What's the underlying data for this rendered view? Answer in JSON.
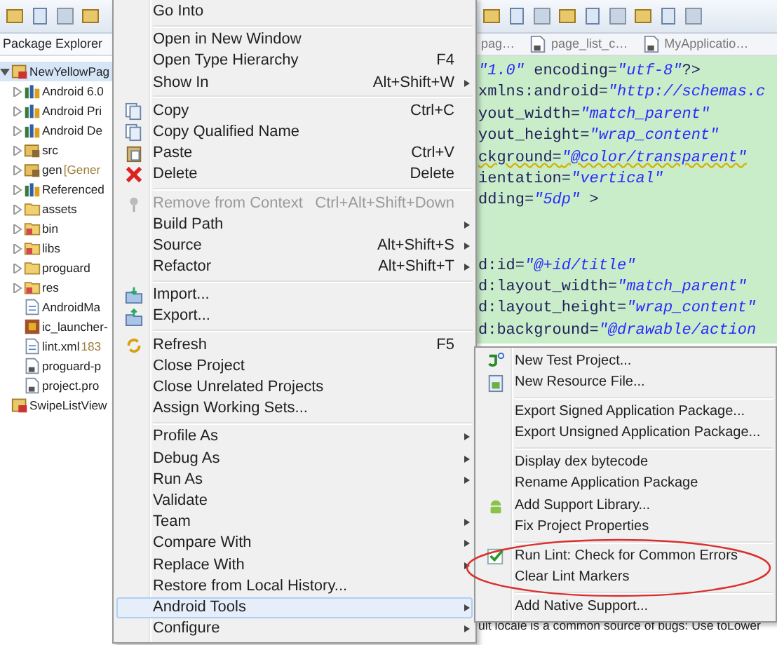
{
  "package_explorer": {
    "title": "Package Explorer",
    "tree": [
      {
        "label": "NewYellowPag",
        "kind": "project",
        "selected": true,
        "expanded": true,
        "children": [
          {
            "label": "Android 6.0",
            "kind": "library",
            "selected": false,
            "expanded": false
          },
          {
            "label": "Android Pri",
            "kind": "library",
            "selected": false,
            "expanded": false
          },
          {
            "label": "Android De",
            "kind": "library",
            "selected": false,
            "expanded": false
          },
          {
            "label": "src",
            "kind": "package",
            "selected": false,
            "expanded": false
          },
          {
            "label": "gen",
            "decoration": "[Gener",
            "kind": "package",
            "selected": false,
            "expanded": false
          },
          {
            "label": "Referenced",
            "kind": "library",
            "selected": false,
            "expanded": false
          },
          {
            "label": "assets",
            "kind": "folder",
            "selected": false,
            "expanded": false
          },
          {
            "label": "bin",
            "kind": "resfolder",
            "selected": false,
            "expanded": false
          },
          {
            "label": "libs",
            "kind": "resfolder",
            "selected": false,
            "expanded": false
          },
          {
            "label": "proguard",
            "kind": "folder",
            "selected": false,
            "expanded": false
          },
          {
            "label": "res",
            "kind": "resfolder",
            "selected": false,
            "expanded": false
          },
          {
            "label": "AndroidMa",
            "kind": "xml",
            "selected": false
          },
          {
            "label": "ic_launcher-",
            "kind": "image",
            "selected": false
          },
          {
            "label": "lint.xml",
            "decoration": "183",
            "kind": "xml",
            "selected": false
          },
          {
            "label": "proguard-p",
            "kind": "file",
            "selected": false
          },
          {
            "label": "project.pro",
            "kind": "file",
            "selected": false
          }
        ]
      },
      {
        "label": "SwipeListView",
        "kind": "project",
        "selected": false
      }
    ]
  },
  "context_menu": {
    "items": [
      {
        "kind": "plain",
        "label": "Go Into",
        "selected": false
      },
      {
        "kind": "separator"
      },
      {
        "kind": "plain",
        "label": "Open in New Window",
        "selected": false
      },
      {
        "kind": "plain",
        "label": "Open Type Hierarchy",
        "shortcut": "F4",
        "selected": false
      },
      {
        "kind": "plain",
        "label": "Show In",
        "shortcut": "Alt+Shift+W",
        "submenu": true,
        "selected": false
      },
      {
        "kind": "separator"
      },
      {
        "kind": "copy",
        "label": "Copy",
        "shortcut": "Ctrl+C",
        "selected": false
      },
      {
        "kind": "copy",
        "label": "Copy Qualified Name",
        "selected": false
      },
      {
        "kind": "paste",
        "label": "Paste",
        "shortcut": "Ctrl+V",
        "selected": false
      },
      {
        "kind": "delete",
        "label": "Delete",
        "shortcut": "Delete",
        "selected": false
      },
      {
        "kind": "separator"
      },
      {
        "kind": "pin",
        "label": "Remove from Context",
        "shortcut": "Ctrl+Alt+Shift+Down",
        "disabled": true,
        "selected": false
      },
      {
        "kind": "plain",
        "label": "Build Path",
        "submenu": true,
        "selected": false
      },
      {
        "kind": "plain",
        "label": "Source",
        "shortcut": "Alt+Shift+S",
        "submenu": true,
        "selected": false
      },
      {
        "kind": "plain",
        "label": "Refactor",
        "shortcut": "Alt+Shift+T",
        "submenu": true,
        "selected": false
      },
      {
        "kind": "separator"
      },
      {
        "kind": "import",
        "label": "Import...",
        "selected": false
      },
      {
        "kind": "export",
        "label": "Export...",
        "selected": false
      },
      {
        "kind": "separator"
      },
      {
        "kind": "refresh",
        "label": "Refresh",
        "shortcut": "F5",
        "selected": false
      },
      {
        "kind": "plain",
        "label": "Close Project",
        "selected": false
      },
      {
        "kind": "plain",
        "label": "Close Unrelated Projects",
        "selected": false
      },
      {
        "kind": "plain",
        "label": "Assign Working Sets...",
        "selected": false
      },
      {
        "kind": "separator"
      },
      {
        "kind": "plain",
        "label": "Profile As",
        "submenu": true,
        "selected": false
      },
      {
        "kind": "plain",
        "label": "Debug As",
        "submenu": true,
        "selected": false
      },
      {
        "kind": "plain",
        "label": "Run As",
        "submenu": true,
        "selected": false
      },
      {
        "kind": "plain",
        "label": "Validate",
        "selected": false
      },
      {
        "kind": "plain",
        "label": "Team",
        "submenu": true,
        "selected": false
      },
      {
        "kind": "plain",
        "label": "Compare With",
        "submenu": true,
        "selected": false
      },
      {
        "kind": "plain",
        "label": "Replace With",
        "submenu": true,
        "selected": false
      },
      {
        "kind": "plain",
        "label": "Restore from Local History...",
        "selected": false
      },
      {
        "kind": "plain",
        "label": "Android Tools",
        "submenu": true,
        "selected": true
      },
      {
        "kind": "plain",
        "label": "Configure",
        "submenu": true,
        "selected": false
      }
    ]
  },
  "android_tools_menu": {
    "items": [
      {
        "kind": "test",
        "label": "New Test Project...",
        "selected": false
      },
      {
        "kind": "newres",
        "label": "New Resource File...",
        "selected": false
      },
      {
        "kind": "separator"
      },
      {
        "kind": "plain",
        "label": "Export Signed Application Package...",
        "selected": false
      },
      {
        "kind": "plain",
        "label": "Export Unsigned Application Package...",
        "selected": false
      },
      {
        "kind": "separator"
      },
      {
        "kind": "plain",
        "label": "Display dex bytecode",
        "selected": false
      },
      {
        "kind": "plain",
        "label": "Rename Application Package",
        "selected": false
      },
      {
        "kind": "android",
        "label": "Add Support Library...",
        "selected": false
      },
      {
        "kind": "plain",
        "label": "Fix Project Properties",
        "selected": false
      },
      {
        "kind": "separator"
      },
      {
        "kind": "check",
        "label": "Run Lint: Check for Common Errors",
        "selected": false
      },
      {
        "kind": "plain",
        "label": "Clear Lint Markers",
        "selected": false
      },
      {
        "kind": "separator"
      },
      {
        "kind": "plain",
        "label": "Add Native Support...",
        "selected": false
      }
    ]
  },
  "annotation": {
    "kind": "ellipse"
  },
  "editor": {
    "tabs": [
      {
        "label": "pag…",
        "selected": false
      },
      {
        "label": "page_list_c…",
        "selected": false
      },
      {
        "label": "MyApplicatio…",
        "selected": false
      }
    ],
    "lines": [
      {
        "kind": "code",
        "segments": [
          {
            "kind": "value",
            "text": "\"1.0\""
          },
          {
            "kind": "plain",
            "text": " encoding="
          },
          {
            "kind": "value",
            "text": "\"utf-8\""
          },
          {
            "kind": "plain",
            "text": "?>"
          }
        ]
      },
      {
        "kind": "code",
        "segments": [
          {
            "kind": "plain",
            "text": "xmlns:android="
          },
          {
            "kind": "value",
            "text": "\"http://schemas.c"
          }
        ]
      },
      {
        "kind": "code",
        "segments": [
          {
            "kind": "plain",
            "text": "yout_width="
          },
          {
            "kind": "value",
            "text": "\"match_parent\""
          }
        ]
      },
      {
        "kind": "code",
        "segments": [
          {
            "kind": "plain",
            "text": "yout_height="
          },
          {
            "kind": "value",
            "text": "\"wrap_content\""
          }
        ]
      },
      {
        "kind": "code",
        "warning": true,
        "segments": [
          {
            "kind": "plain",
            "text": "ckground="
          },
          {
            "kind": "value",
            "text": "\"@color/transparent\""
          }
        ]
      },
      {
        "kind": "code",
        "segments": [
          {
            "kind": "plain",
            "text": "ientation="
          },
          {
            "kind": "value",
            "text": "\"vertical\""
          }
        ]
      },
      {
        "kind": "code",
        "segments": [
          {
            "kind": "plain",
            "text": "dding="
          },
          {
            "kind": "value",
            "text": "\"5dp\""
          },
          {
            "kind": "plain",
            "text": " >"
          }
        ]
      },
      {
        "kind": "blank"
      },
      {
        "kind": "blank"
      },
      {
        "kind": "code",
        "segments": [
          {
            "kind": "plain",
            "text": "d:id="
          },
          {
            "kind": "value",
            "text": "\"@+id/title\""
          }
        ]
      },
      {
        "kind": "code",
        "segments": [
          {
            "kind": "plain",
            "text": "d:layout_width="
          },
          {
            "kind": "value",
            "text": "\"match_parent\""
          }
        ]
      },
      {
        "kind": "code",
        "segments": [
          {
            "kind": "plain",
            "text": "d:layout_height="
          },
          {
            "kind": "value",
            "text": "\"wrap_content\""
          }
        ]
      },
      {
        "kind": "code",
        "segments": [
          {
            "kind": "plain",
            "text": "d:background="
          },
          {
            "kind": "value",
            "text": "\"@drawable/action"
          }
        ]
      }
    ],
    "problem_text": "ult locale is a common source of bugs: Use toLower"
  }
}
